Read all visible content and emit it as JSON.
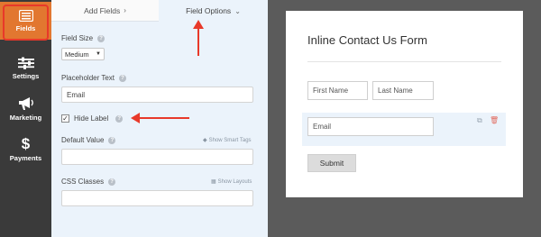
{
  "sidebar": {
    "items": [
      {
        "label": "Fields",
        "icon": "fields-icon",
        "active": true
      },
      {
        "label": "Settings",
        "icon": "sliders-icon"
      },
      {
        "label": "Marketing",
        "icon": "megaphone-icon"
      },
      {
        "label": "Payments",
        "icon": "dollar-icon"
      }
    ]
  },
  "panel": {
    "tabs": {
      "add_fields": "Add Fields",
      "field_options": "Field Options"
    },
    "field_size": {
      "label": "Field Size",
      "value": "Medium"
    },
    "placeholder": {
      "label": "Placeholder Text",
      "value": "Email"
    },
    "hide_label": {
      "label": "Hide Label",
      "checked": true
    },
    "default_value": {
      "label": "Default Value",
      "link": "Show Smart Tags",
      "value": ""
    },
    "css_classes": {
      "label": "CSS Classes",
      "link": "Show Layouts",
      "value": ""
    }
  },
  "preview": {
    "form_title": "Inline Contact Us Form",
    "first_name_placeholder": "First Name",
    "last_name_placeholder": "Last Name",
    "email_placeholder": "Email",
    "submit_label": "Submit"
  },
  "colors": {
    "accent_orange": "#e27730",
    "annotation_red": "#e8392a",
    "sidebar_bg": "#3a3a3a",
    "panel_bg": "#ebf3fb"
  }
}
